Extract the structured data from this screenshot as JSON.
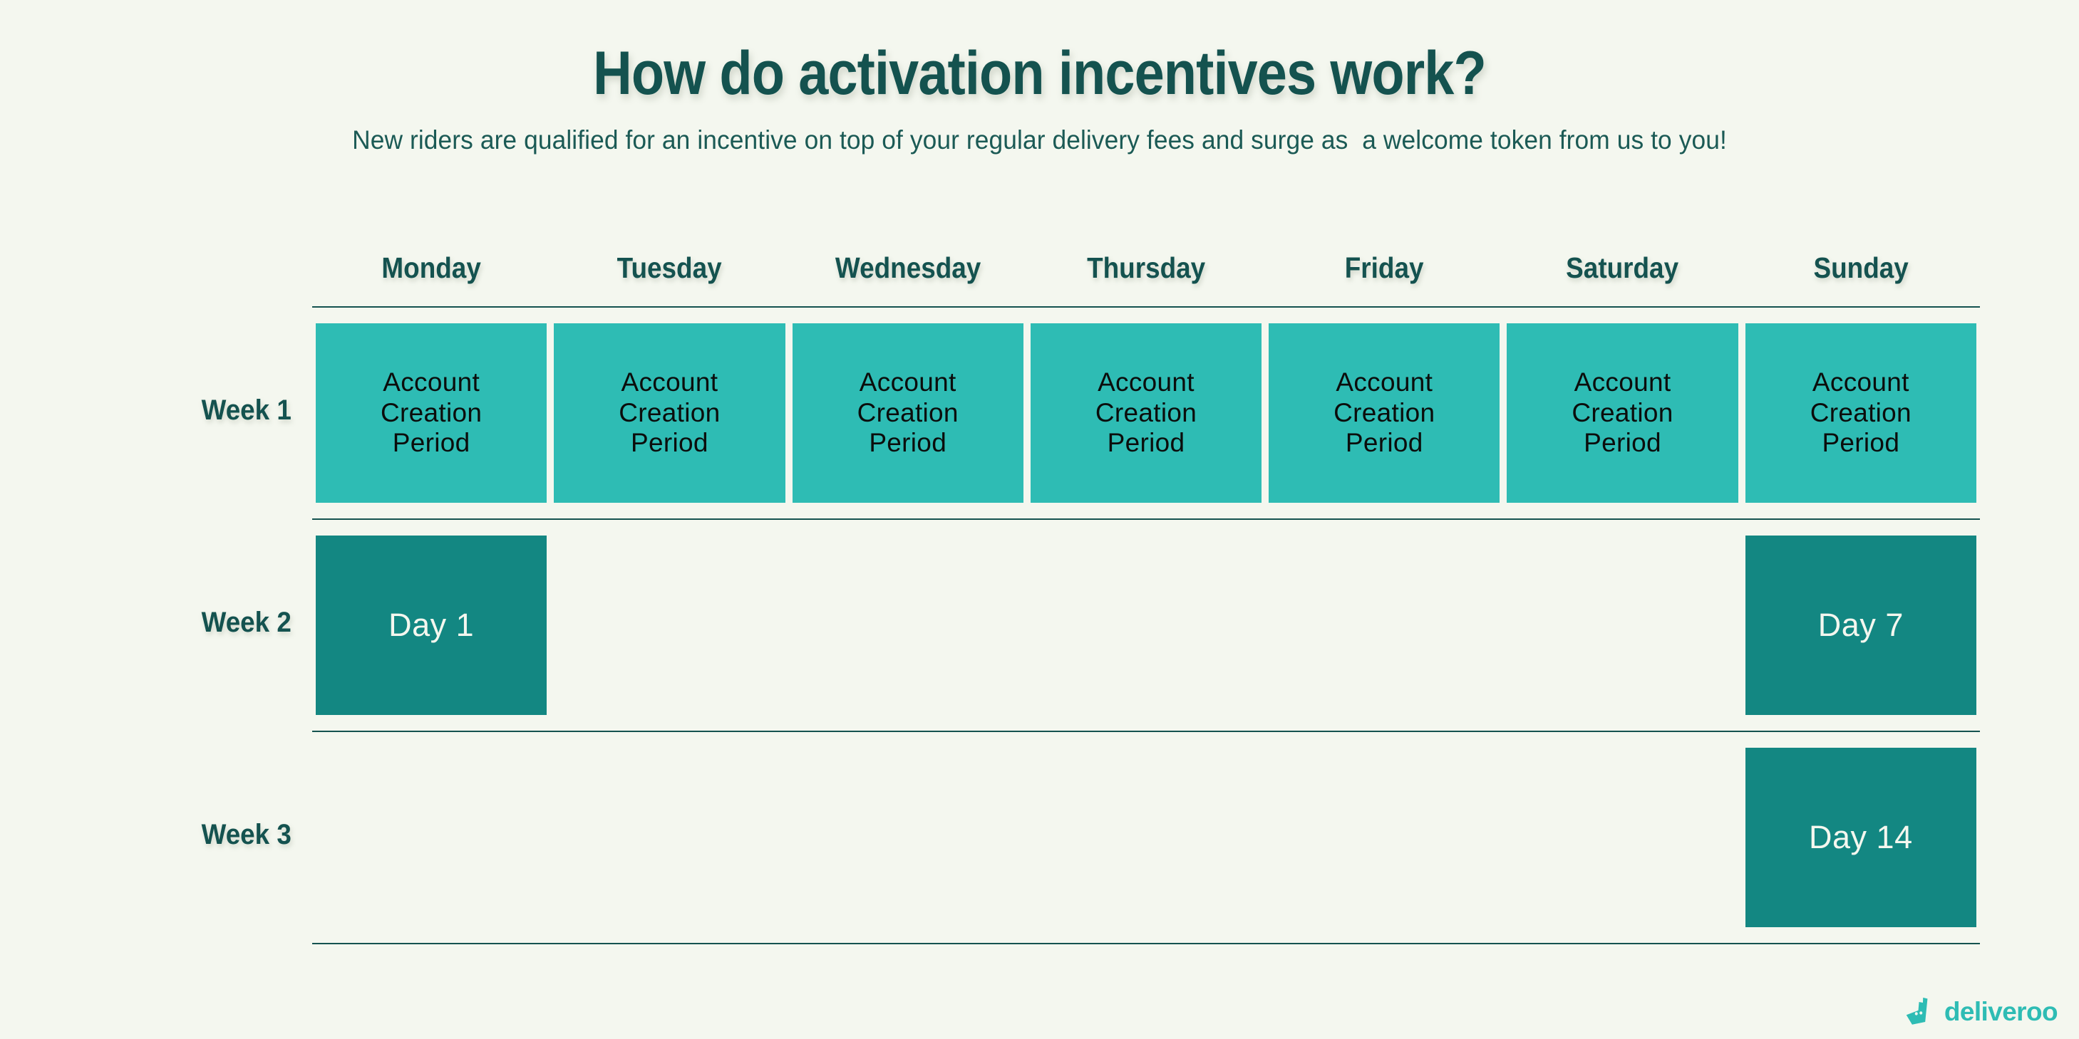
{
  "header": {
    "title": "How do activation incentives work?",
    "subtitle": "New riders are qualified for an incentive on top of your regular delivery fees and surge as  a welcome token from us to you!"
  },
  "colors": {
    "background": "#f4f7ef",
    "dark_teal": "#14524f",
    "light_cell": "#2ebcb4",
    "dark_cell": "#138782",
    "brand": "#2ebcb4"
  },
  "calendar": {
    "weekdays": [
      "Monday",
      "Tuesday",
      "Wednesday",
      "Thursday",
      "Friday",
      "Saturday",
      "Sunday"
    ],
    "weeks": [
      {
        "label": "Week 1",
        "cells": [
          {
            "text": "Account\nCreation\nPeriod",
            "style": "light"
          },
          {
            "text": "Account\nCreation\nPeriod",
            "style": "light"
          },
          {
            "text": "Account\nCreation\nPeriod",
            "style": "light"
          },
          {
            "text": "Account\nCreation\nPeriod",
            "style": "light"
          },
          {
            "text": "Account\nCreation\nPeriod",
            "style": "light"
          },
          {
            "text": "Account\nCreation\nPeriod",
            "style": "light"
          },
          {
            "text": "Account\nCreation\nPeriod",
            "style": "light"
          }
        ]
      },
      {
        "label": "Week 2",
        "cells": [
          {
            "text": "Day 1",
            "style": "dark"
          },
          {
            "text": "",
            "style": "empty"
          },
          {
            "text": "",
            "style": "empty"
          },
          {
            "text": "",
            "style": "empty"
          },
          {
            "text": "",
            "style": "empty"
          },
          {
            "text": "",
            "style": "empty"
          },
          {
            "text": "Day 7",
            "style": "dark"
          }
        ]
      },
      {
        "label": "Week 3",
        "cells": [
          {
            "text": "",
            "style": "empty"
          },
          {
            "text": "",
            "style": "empty"
          },
          {
            "text": "",
            "style": "empty"
          },
          {
            "text": "",
            "style": "empty"
          },
          {
            "text": "",
            "style": "empty"
          },
          {
            "text": "",
            "style": "empty"
          },
          {
            "text": "Day 14",
            "style": "dark"
          }
        ]
      }
    ]
  },
  "logo": {
    "wordmark": "deliveroo",
    "mark_icon": "deliveroo-kangaroo-icon"
  }
}
